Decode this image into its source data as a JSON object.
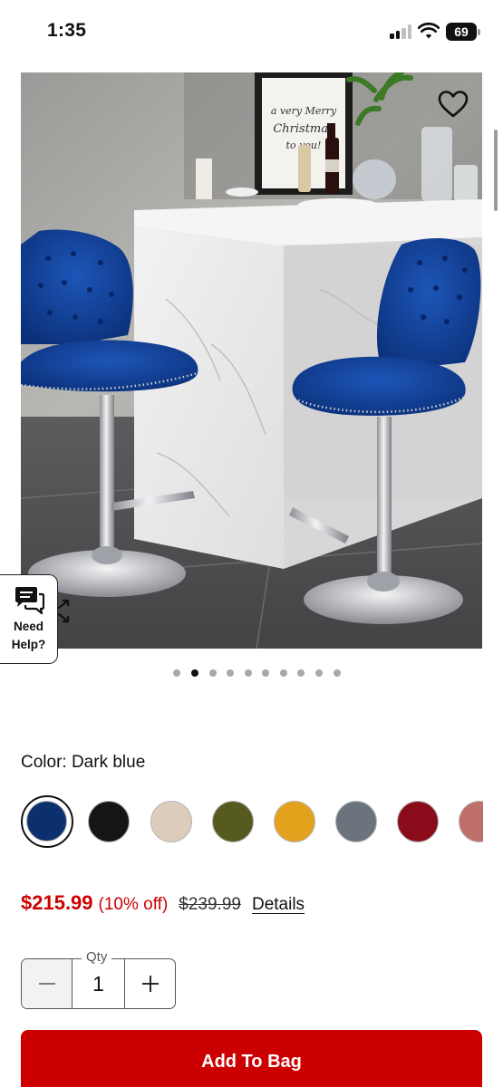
{
  "status_bar": {
    "time": "1:35",
    "battery": "69",
    "icons": [
      "signal-icon",
      "wifi-icon",
      "battery-icon"
    ]
  },
  "product_image": {
    "favorite_icon": "heart-icon",
    "expand_icon": "expand-icon",
    "photo_caption": "a very Merry Christmas to you!"
  },
  "help": {
    "icon": "chat-bubbles-icon",
    "line1": "Need",
    "line2": "Help?"
  },
  "carousel": {
    "total": 10,
    "active_index": 1
  },
  "color": {
    "label": "Color: Dark blue",
    "swatches": [
      {
        "name": "Dark blue",
        "hex": "#0c2f6e",
        "selected": true
      },
      {
        "name": "Black",
        "hex": "#151515"
      },
      {
        "name": "Beige",
        "hex": "#ddccbc"
      },
      {
        "name": "Olive",
        "hex": "#565a1e"
      },
      {
        "name": "Mustard",
        "hex": "#e3a21c"
      },
      {
        "name": "Gray",
        "hex": "#6b747d"
      },
      {
        "name": "Burgundy",
        "hex": "#8a0c1b"
      },
      {
        "name": "Rose",
        "hex": "#c0706a"
      }
    ]
  },
  "price": {
    "current": "$215.99",
    "discount": "(10% off)",
    "original": "$239.99",
    "details_link": "Details"
  },
  "quantity": {
    "label": "Qty",
    "value": "1",
    "minus_icon": "minus-icon",
    "plus_icon": "plus-icon"
  },
  "cart": {
    "add_button": "Add To Bag"
  },
  "colors": {
    "accent_red": "#cc0000",
    "text": "#111111"
  }
}
